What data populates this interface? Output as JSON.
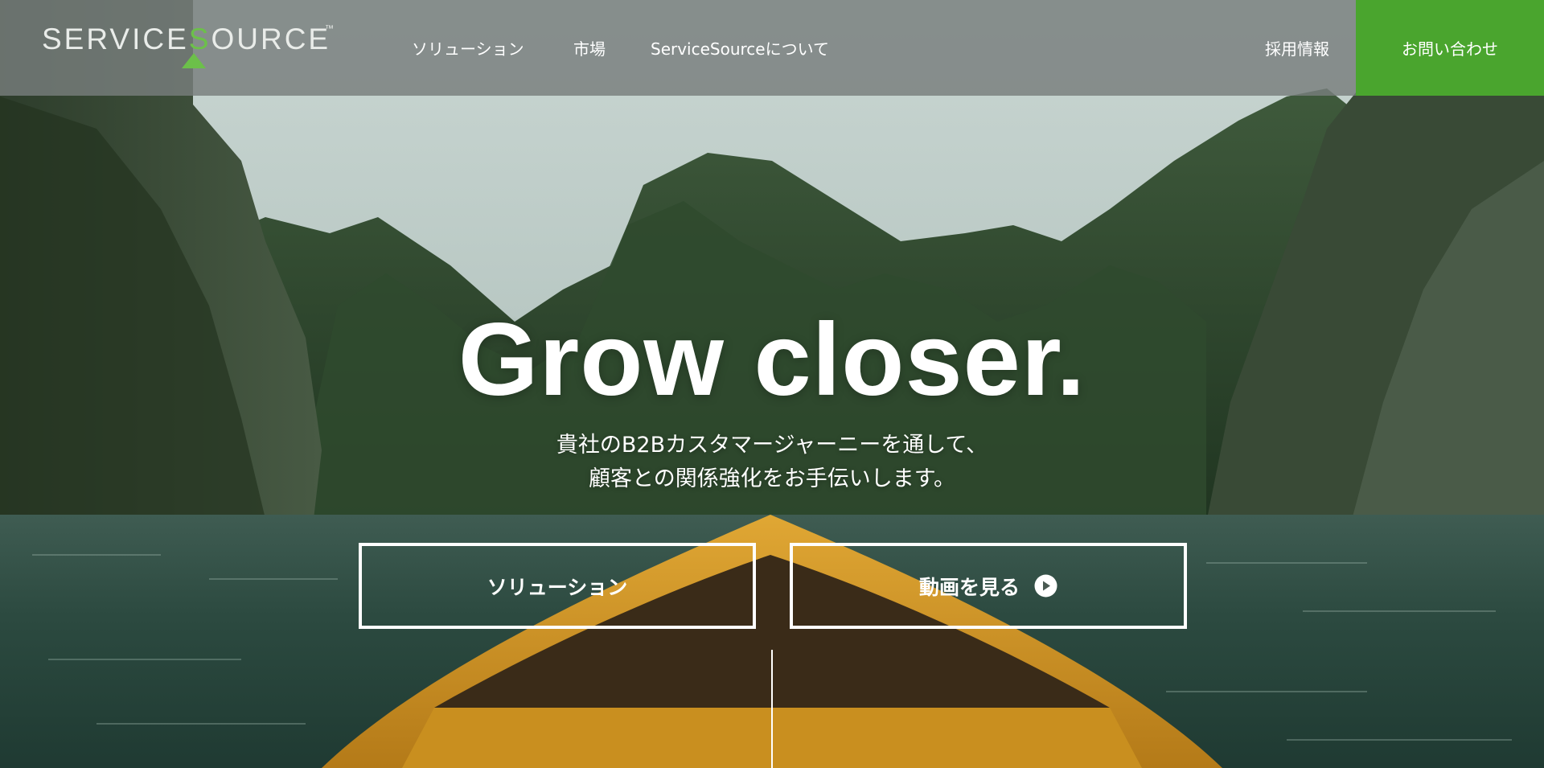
{
  "brand": {
    "logo_prefix": "SERVICE",
    "logo_accent": "S",
    "logo_suffix": "OURCE",
    "trademark": "™",
    "accent_color": "#6cc04a"
  },
  "nav": {
    "solutions": "ソリューション",
    "markets": "市場",
    "about": "ServiceSourceについて",
    "careers": "採用情報",
    "contact": "お問い合わせ",
    "contact_color": "#4aa52e"
  },
  "hero": {
    "title": "Grow closer.",
    "subtitle_line1": "貴社のB2Bカスタマージャーニーを通して、",
    "subtitle_line2": "顧客との関係強化をお手伝いします。"
  },
  "cta": {
    "solutions_label": "ソリューション",
    "video_label": "動画を見る",
    "video_icon": "play-circle-icon"
  }
}
